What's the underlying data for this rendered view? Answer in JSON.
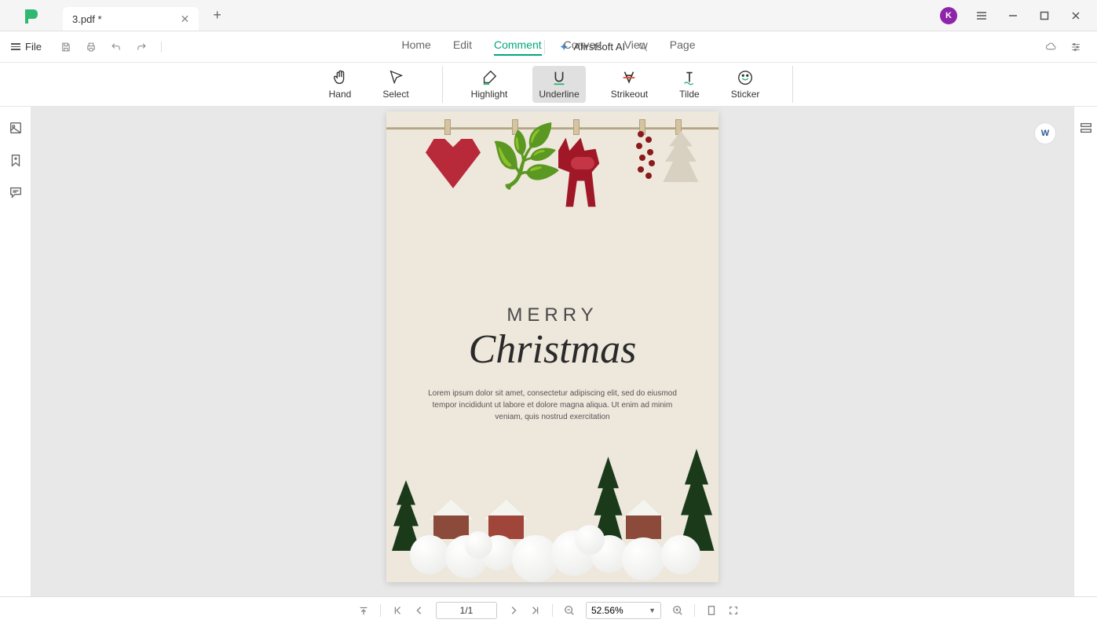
{
  "titlebar": {
    "tab_title": "3.pdf *",
    "avatar_letter": "K"
  },
  "menubar": {
    "file_label": "File",
    "tabs": {
      "home": "Home",
      "edit": "Edit",
      "comment": "Comment",
      "convert": "Convert",
      "view": "View",
      "page": "Page"
    },
    "ai_label": "Afirstsoft AI"
  },
  "ribbon": {
    "hand": "Hand",
    "select": "Select",
    "highlight": "Highlight",
    "underline": "Underline",
    "strikeout": "Strikeout",
    "tilde": "Tilde",
    "sticker": "Sticker"
  },
  "document": {
    "line1": "MERRY",
    "line2": "Christmas",
    "body": "Lorem ipsum dolor sit amet, consectetur adipiscing elit, sed do eiusmod tempor incididunt ut labore et dolore magna aliqua. Ut enim ad minim veniam, quis nostrud exercitation"
  },
  "statusbar": {
    "page_display": "1/1",
    "zoom_level": "52.56%"
  },
  "float_badge": "W"
}
